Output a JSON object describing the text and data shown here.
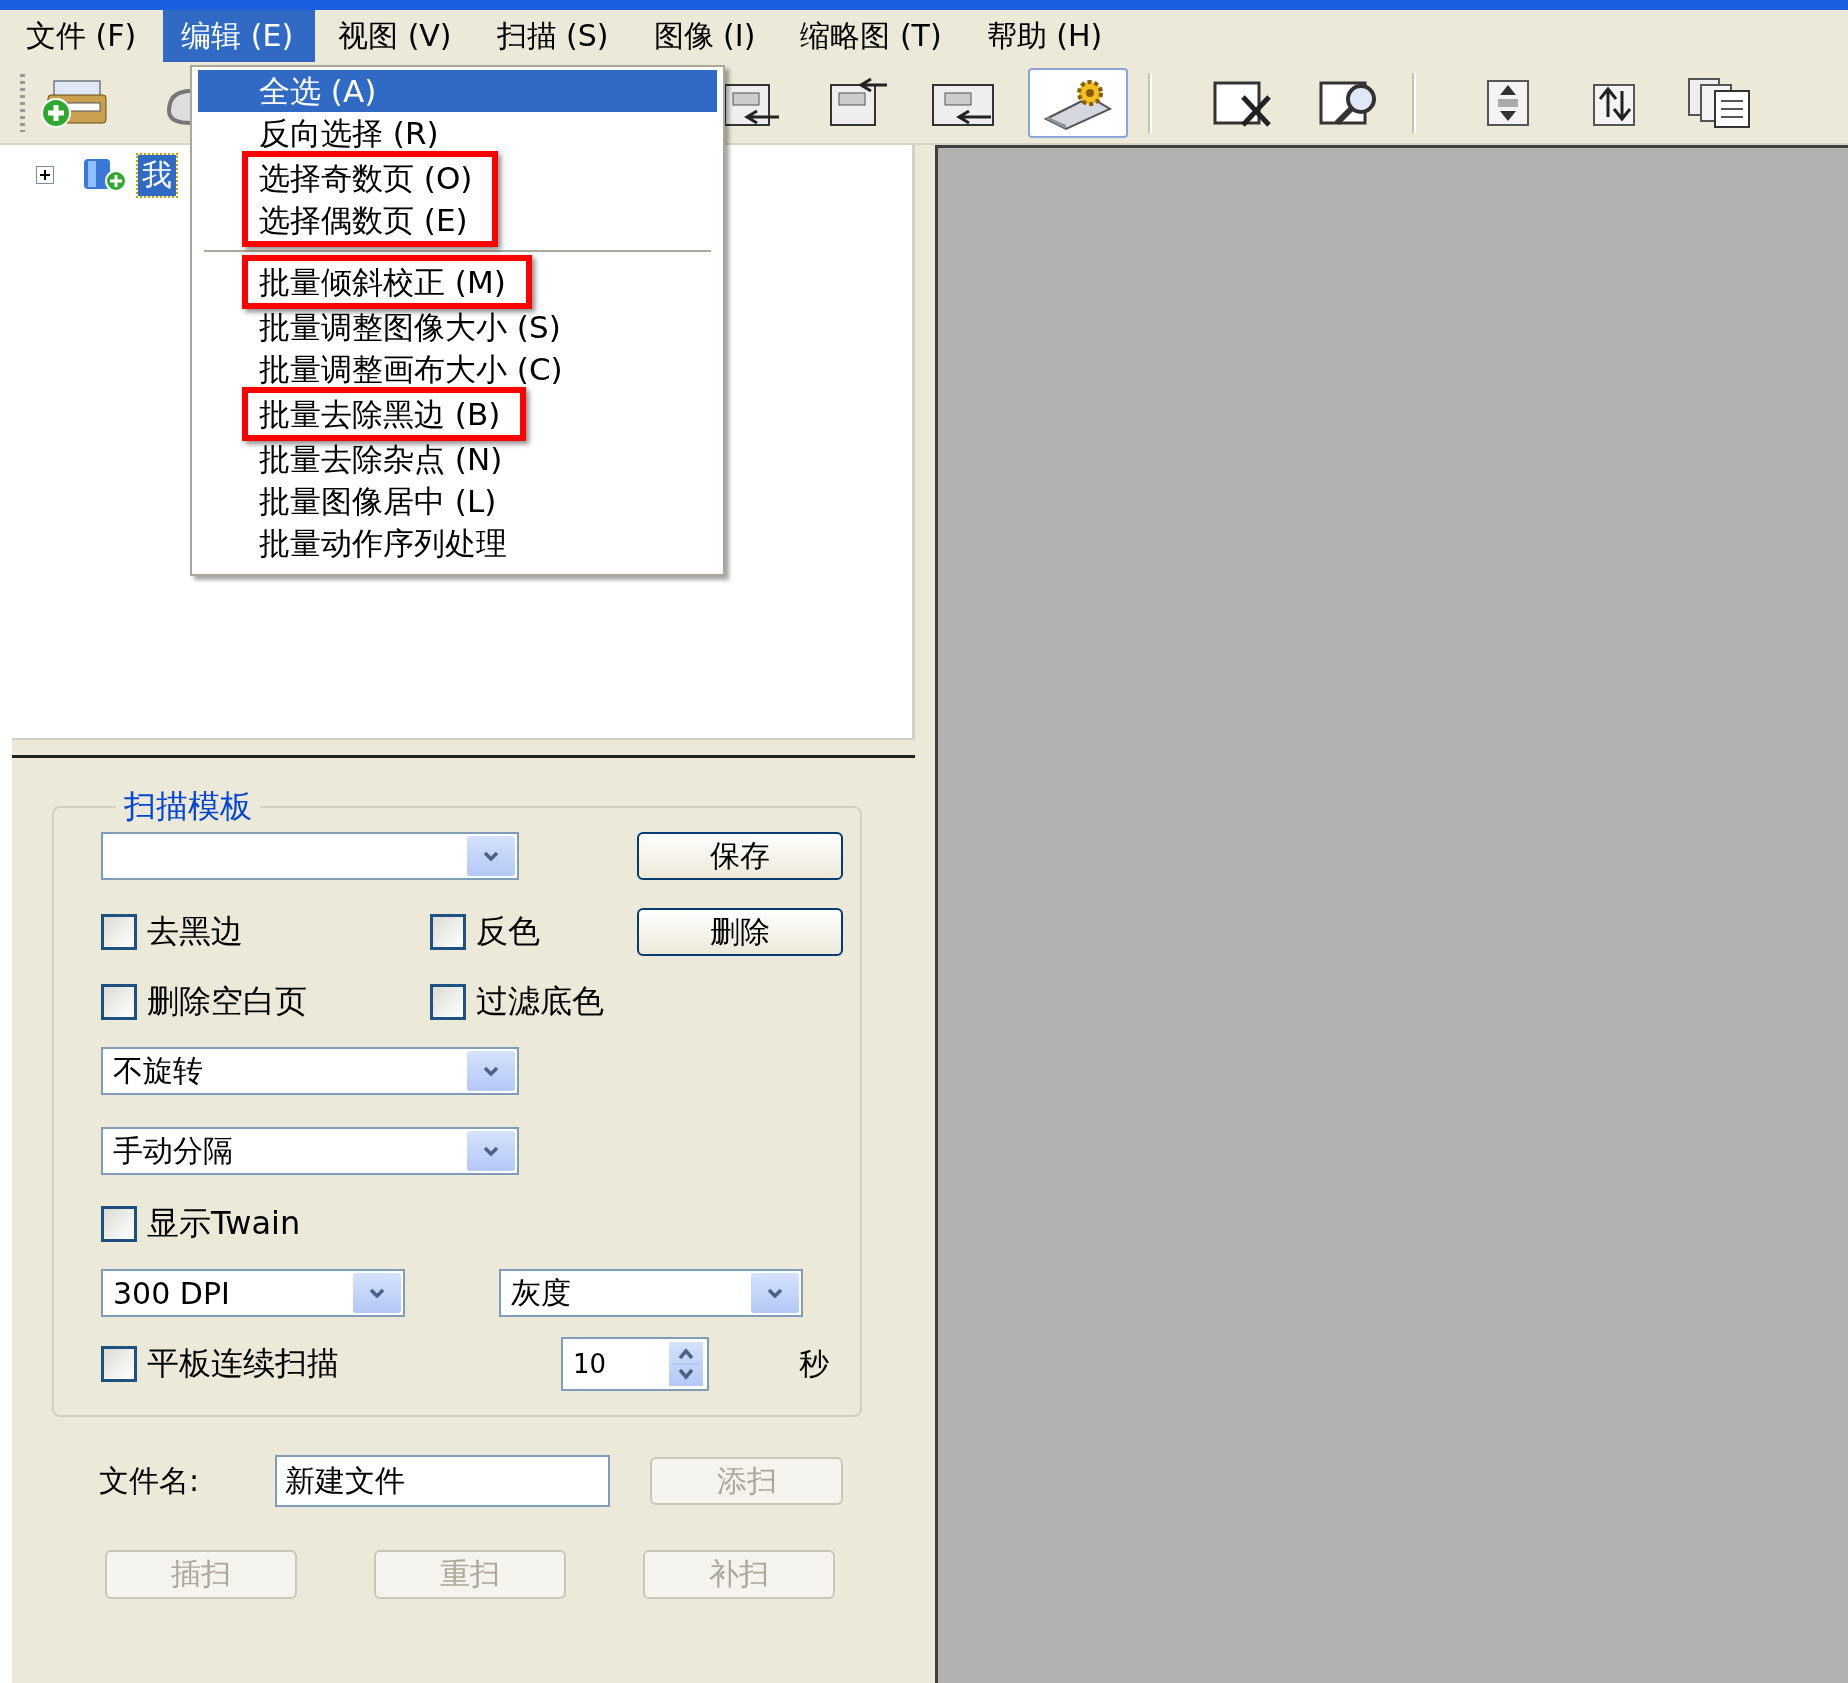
{
  "menu_bar": [
    {
      "label": "文件 (F)",
      "selected": false
    },
    {
      "label": "编辑 (E)",
      "selected": true
    },
    {
      "label": "视图 (V)",
      "selected": false
    },
    {
      "label": "扫描 (S)",
      "selected": false
    },
    {
      "label": "图像 (I)",
      "selected": false
    },
    {
      "label": "缩略图 (T)",
      "selected": false
    },
    {
      "label": "帮助 (H)",
      "selected": false
    }
  ],
  "toolbar": [
    {
      "kind": "scanner-add",
      "selected": false
    },
    {
      "kind": "partial",
      "selected": false
    },
    {
      "kind": "page-in",
      "selected": false
    },
    {
      "kind": "page-out",
      "selected": false
    },
    {
      "kind": "page-swap",
      "selected": false
    },
    {
      "kind": "settings",
      "selected": true
    },
    {
      "kind": "page-delete",
      "selected": false
    },
    {
      "kind": "page-zoom",
      "selected": false
    },
    {
      "kind": "move-updown",
      "selected": false
    },
    {
      "kind": "page-updown",
      "selected": false
    },
    {
      "kind": "page-copy",
      "selected": false
    }
  ],
  "edit_menu": [
    {
      "kind": "items",
      "annotated": false,
      "items": [
        {
          "label": "全选 (A)",
          "selected": true
        },
        {
          "label": "反向选择 (R)",
          "selected": false
        }
      ]
    },
    {
      "kind": "items",
      "annotated": true,
      "items": [
        {
          "label": "选择奇数页 (O)",
          "selected": false
        },
        {
          "label": "选择偶数页 (E)",
          "selected": false
        }
      ]
    },
    {
      "kind": "separator"
    },
    {
      "kind": "items",
      "annotated": true,
      "items": [
        {
          "label": "批量倾斜校正 (M)",
          "selected": false
        }
      ]
    },
    {
      "kind": "items",
      "annotated": false,
      "items": [
        {
          "label": "批量调整图像大小 (S)",
          "selected": false
        },
        {
          "label": "批量调整画布大小 (C)",
          "selected": false
        }
      ]
    },
    {
      "kind": "items",
      "annotated": true,
      "items": [
        {
          "label": "批量去除黑边 (B)",
          "selected": false
        }
      ]
    },
    {
      "kind": "items",
      "annotated": false,
      "items": [
        {
          "label": "批量去除杂点 (N)",
          "selected": false
        },
        {
          "label": "批量图像居中 (L)",
          "selected": false
        },
        {
          "label": "批量动作序列处理",
          "selected": false
        }
      ]
    }
  ],
  "tree": [
    {
      "label": "我",
      "expanded": false,
      "selected": true
    }
  ],
  "scan_template": {
    "legend": "扫描模板",
    "save_button": "保存",
    "delete_button": "删除",
    "checkboxes": [
      {
        "label": "去黑边",
        "checked": false
      },
      {
        "label": "反色",
        "checked": false
      },
      {
        "label": "删除空白页",
        "checked": false
      },
      {
        "label": "过滤底色",
        "checked": false
      },
      {
        "label": "显示Twain",
        "checked": false
      },
      {
        "label": "平板连续扫描",
        "checked": false
      }
    ],
    "rotation": "不旋转",
    "separation": "手动分隔",
    "resolution": "300 DPI",
    "color_mode": "灰度",
    "interval": "10",
    "interval_unit": "秒"
  },
  "file_name": {
    "label": "文件名:",
    "value": "新建文件"
  },
  "buttons": [
    {
      "label": "添扫",
      "disabled": true
    },
    {
      "label": "插扫",
      "disabled": true
    },
    {
      "label": "重扫",
      "disabled": true
    },
    {
      "label": "补扫",
      "disabled": true
    }
  ]
}
